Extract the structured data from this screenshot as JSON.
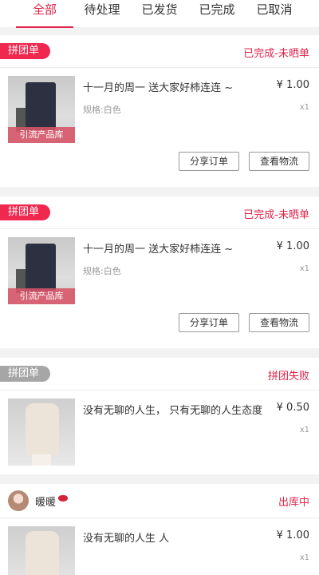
{
  "tabs": [
    {
      "label": "全部",
      "active": true
    },
    {
      "label": "待处理",
      "active": false
    },
    {
      "label": "已发货",
      "active": false
    },
    {
      "label": "已完成",
      "active": false
    },
    {
      "label": "已取消",
      "active": false
    }
  ],
  "orders": [
    {
      "tag": "拼团单",
      "status": "已完成-未晒单",
      "item": {
        "title": "十一月的周一 送大家好柿连连 ~",
        "spec": "规格:白色",
        "price": "¥ 1.00",
        "qty": "x1",
        "thumb_label": "引流产品库"
      },
      "actions": {
        "share": "分享订单",
        "track": "查看物流"
      }
    },
    {
      "tag": "拼团单",
      "status": "已完成-未晒单",
      "item": {
        "title": "十一月的周一 送大家好柿连连 ~",
        "spec": "规格:白色",
        "price": "¥ 1.00",
        "qty": "x1",
        "thumb_label": "引流产品库"
      },
      "actions": {
        "share": "分享订单",
        "track": "查看物流"
      }
    },
    {
      "tag": "拼团单",
      "status": "拼团失败",
      "item": {
        "title": "没有无聊的人生， 只有无聊的人生态度",
        "price": "¥ 0.50",
        "qty": "x1"
      }
    },
    {
      "user": "暖暖",
      "status": "出库中",
      "item": {
        "title": "没有无聊的人生 人",
        "price": "¥ 1.00",
        "qty": "x1"
      }
    }
  ],
  "colors": {
    "accent": "#e0234a",
    "pill_red": "#f0284f",
    "pill_gray": "#a6a6a6"
  }
}
